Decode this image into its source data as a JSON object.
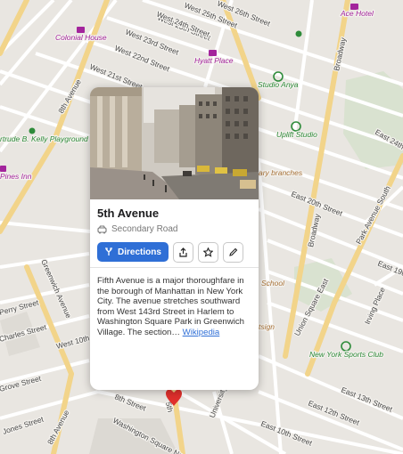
{
  "map": {
    "streets": [
      "West 25th Street",
      "West 26th Street",
      "West 24th Street",
      "West 23rd Street",
      "West 22nd Street",
      "West 21st Street",
      "8th Avenue",
      "Broadway",
      "East 24th Street",
      "Park Avenue South",
      "East 20th Street",
      "Broadway",
      "East 19th Street",
      "Union Square East",
      "Irving Place",
      "Greenwich Avenue",
      "Perry Street",
      "Charles Street",
      "West 10th",
      "Jones Street",
      "8th Street",
      "Washington Square North",
      "University",
      "5th",
      "East 12th Street",
      "East 13th Street",
      "East 10th Street",
      "8th Avenue",
      "Grove Street",
      "8th Avenue"
    ],
    "pois": {
      "ace_hotel": "Ace Hotel",
      "colonial_house": "Colonial House",
      "hyatt_place": "Hyatt Place",
      "studio_anya": "Studio Anya",
      "uplift_studio": "Uplift Studio",
      "gertrude_playground": "rtrude B. Kelly Playground",
      "pines_inn": "Pines Inn",
      "library_branches": "ary branches",
      "school": "School",
      "tsign": "tsign",
      "ny_sports_club": "New York Sports Club"
    },
    "colors": {
      "background": "#e9e6e1",
      "major_road": "#f2d48a",
      "minor_road": "#ffffff",
      "park": "#cfdfc4",
      "purple_poi": "#a3249c",
      "green_poi": "#2e8b3a",
      "marker": "#e0302c"
    }
  },
  "popup": {
    "title": "5th Avenue",
    "subtype_icon": "car-icon",
    "subtype": "Secondary Road",
    "directions_label": "Directions",
    "actions": [
      "share-icon",
      "star-icon",
      "pencil-icon"
    ],
    "description": "Fifth Avenue is a major thoroughfare in the borough of Manhattan in New York City. The avenue stretches southward from West 143rd Street in Harlem to Washington Square Park in Greenwich Village. The section…",
    "link_label": "Wikipedia",
    "accent_color": "#2f6fd6"
  }
}
